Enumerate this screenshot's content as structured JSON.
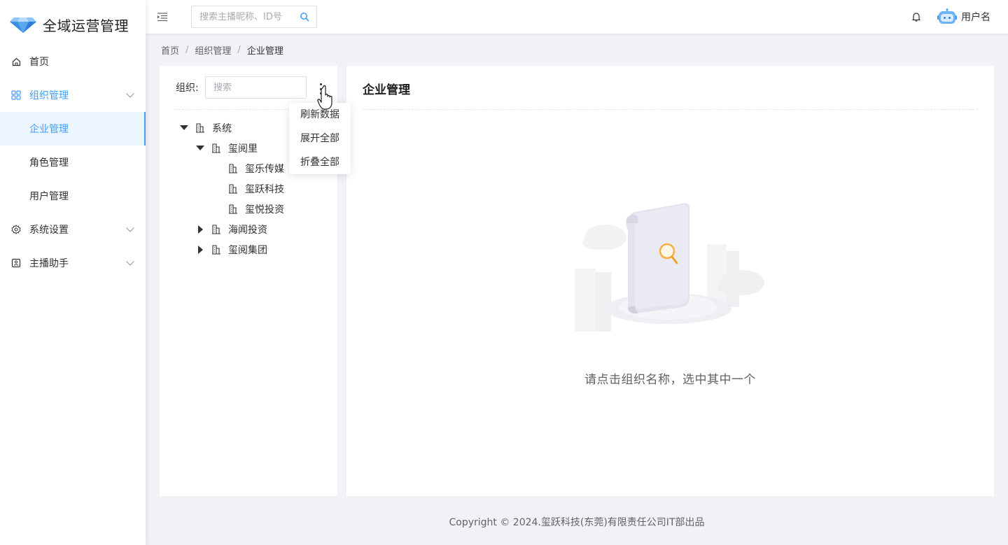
{
  "app": {
    "title": "全域运营管理",
    "brand_color": "#409eff"
  },
  "sidebar": {
    "items": [
      {
        "label": "首页",
        "icon": "home-icon"
      },
      {
        "label": "组织管理",
        "icon": "grid-icon",
        "expanded": true,
        "children": [
          {
            "label": "企业管理",
            "selected": true
          },
          {
            "label": "角色管理"
          },
          {
            "label": "用户管理"
          }
        ]
      },
      {
        "label": "系统设置",
        "icon": "gear-icon"
      },
      {
        "label": "主播助手",
        "icon": "assistant-icon"
      }
    ]
  },
  "header": {
    "search_placeholder": "搜索主播昵称、ID号",
    "username": "用户名"
  },
  "breadcrumb": [
    "首页",
    "组织管理",
    "企业管理"
  ],
  "org_panel": {
    "label": "组织:",
    "search_placeholder": "搜索",
    "menu": [
      "刷新数据",
      "展开全部",
      "折叠全部"
    ],
    "tree": [
      {
        "label": "系统",
        "level": 0,
        "state": "expanded"
      },
      {
        "label": "玺阅里",
        "level": 1,
        "state": "expanded"
      },
      {
        "label": "玺乐传媒",
        "level": 2,
        "state": "leaf"
      },
      {
        "label": "玺跃科技",
        "level": 2,
        "state": "leaf"
      },
      {
        "label": "玺悦投资",
        "level": 2,
        "state": "leaf"
      },
      {
        "label": "海闻投资",
        "level": 1,
        "state": "collapsed"
      },
      {
        "label": "玺阅集团",
        "level": 1,
        "state": "collapsed"
      }
    ]
  },
  "detail_panel": {
    "title": "企业管理",
    "empty_text": "请点击组织名称，选中其中一个"
  },
  "footer": {
    "text": "Copyright © 2024.玺跃科技(东莞)有限责任公司IT部出品"
  }
}
